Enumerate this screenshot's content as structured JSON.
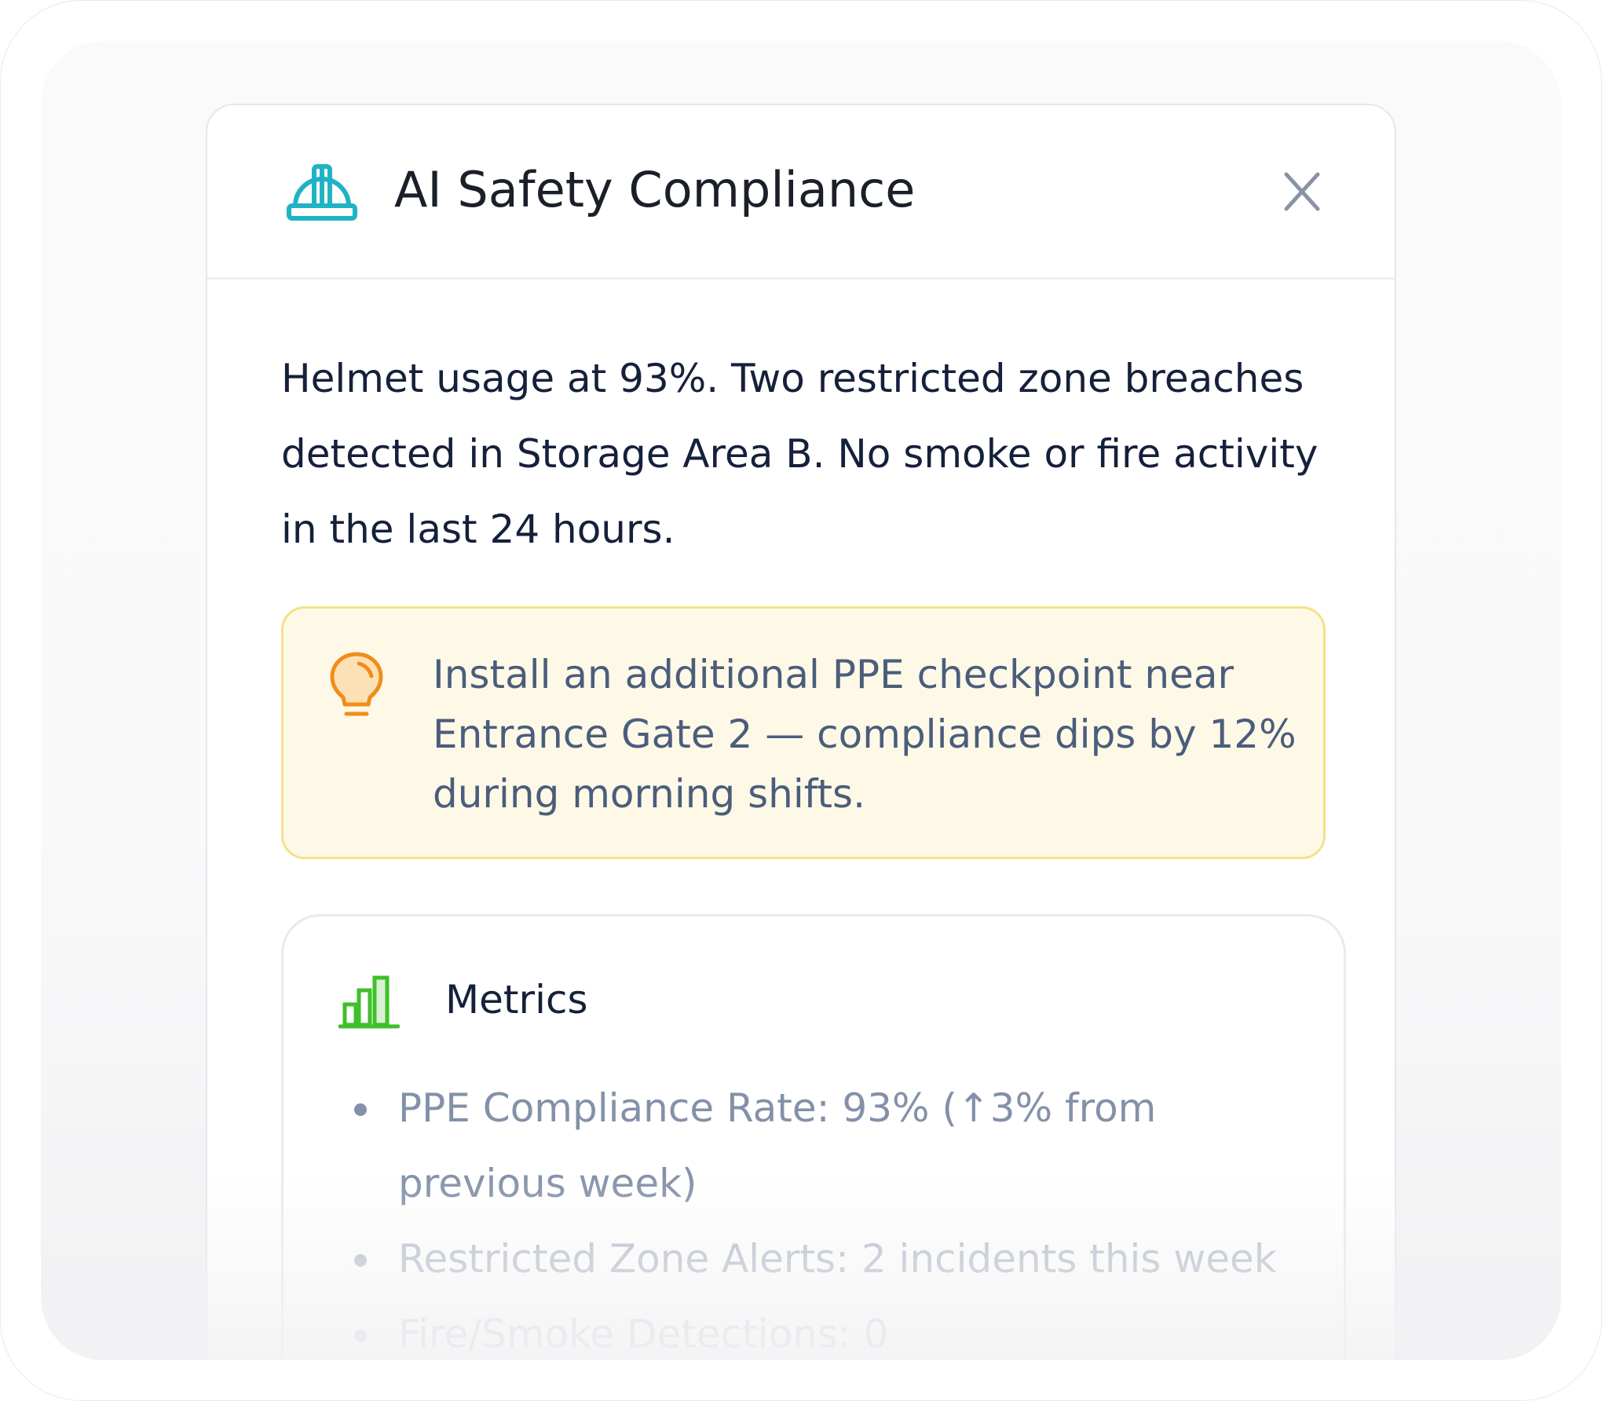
{
  "panel": {
    "title": "AI Safety Compliance",
    "header_icon": "helmet-icon",
    "close_icon": "close-icon"
  },
  "summary": {
    "text": "Helmet usage at 93%. Two restricted zone breaches detected in Storage Area B. No smoke or fire activity in the last 24 hours."
  },
  "recommendation": {
    "icon": "lightbulb-icon",
    "text": "Install an additional PPE checkpoint near Entrance Gate 2 — compliance dips by 12% during morning shifts."
  },
  "metrics": {
    "icon": "bar-chart-icon",
    "title": "Metrics",
    "items": [
      "PPE Compliance Rate: 93% (↑3% from previous week)",
      "Restricted Zone Alerts: 2 incidents this week",
      "Fire/Smoke Detections: 0"
    ]
  },
  "colors": {
    "helmet_accent": "#1fb3c4",
    "tip_background": "#fef9e6",
    "tip_border": "#f6e08a",
    "bulb_accent": "#f28c1a",
    "chart_accent": "#3fbf2a",
    "title_text": "#1a1f29",
    "muted_text": "#4b5d7c"
  }
}
